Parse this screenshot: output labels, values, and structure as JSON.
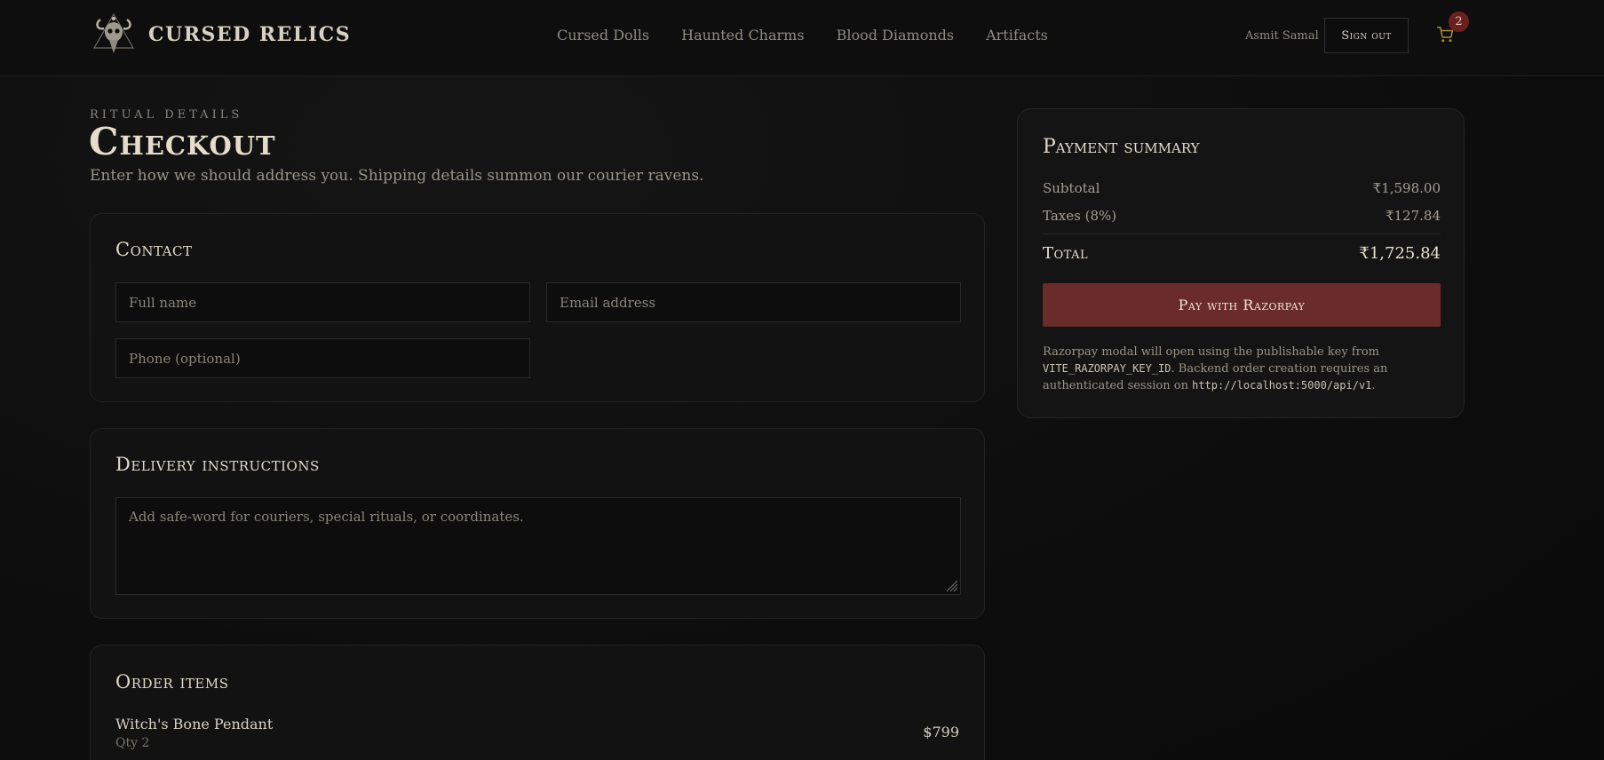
{
  "header": {
    "brand": "CURSED RELICS",
    "nav": [
      "Cursed Dolls",
      "Haunted Charms",
      "Blood Diamonds",
      "Artifacts"
    ],
    "user_name": "Asmit Samal",
    "signout_label": "Sign out",
    "cart_count": "2"
  },
  "intro": {
    "eyebrow": "Ritual details",
    "title": "Checkout",
    "subtitle": "Enter how we should address you. Shipping details summon our courier ravens."
  },
  "contact": {
    "heading": "Contact",
    "full_name_placeholder": "Full name",
    "email_placeholder": "Email address",
    "phone_placeholder": "Phone (optional)"
  },
  "delivery": {
    "heading": "Delivery instructions",
    "placeholder": "Add safe-word for couriers, special rituals, or coordinates."
  },
  "order": {
    "heading": "Order items",
    "items": [
      {
        "name": "Witch's Bone Pendant",
        "qty": "Qty 2",
        "price": "$799"
      }
    ]
  },
  "summary": {
    "heading": "Payment summary",
    "subtotal_label": "Subtotal",
    "subtotal_value": "₹1,598.00",
    "taxes_label": "Taxes (8%)",
    "taxes_value": "₹127.84",
    "total_label": "Total",
    "total_value": "₹1,725.84",
    "pay_label": "Pay with Razorpay",
    "note_part1": "Razorpay modal will open using the publishable key from ",
    "note_code1": "VITE_RAZORPAY_KEY_ID",
    "note_part2": ". Backend order creation requires an authenticated session on ",
    "note_code2": "http://localhost:5000/api/v1",
    "note_part3": "."
  },
  "colors": {
    "accent_button": "#6a2b2b",
    "badge": "#6b2020",
    "background": "#0d0d0d"
  }
}
